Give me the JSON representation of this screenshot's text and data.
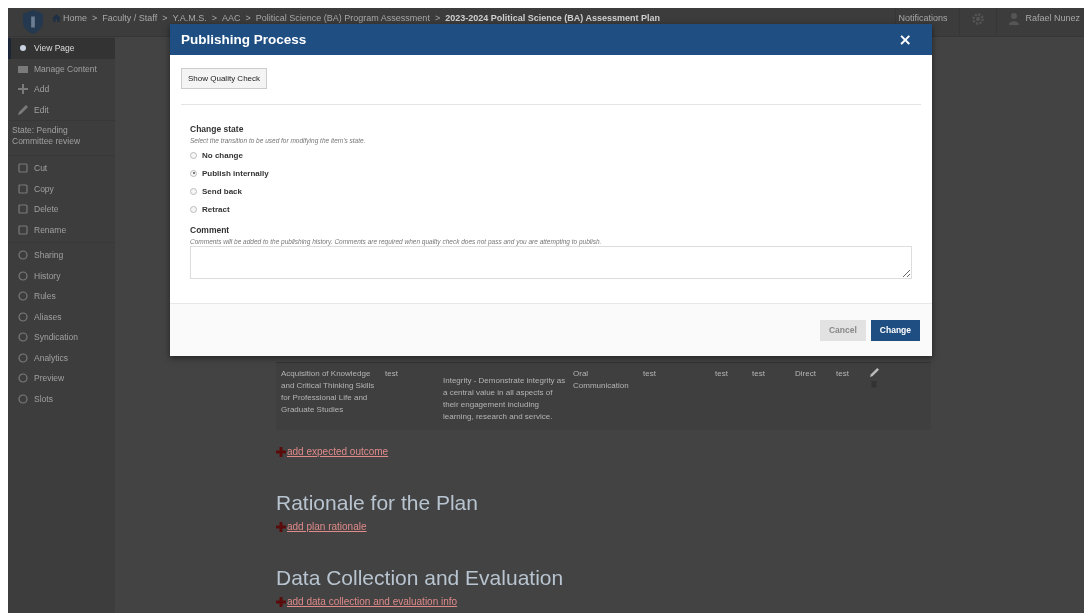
{
  "breadcrumb": [
    {
      "label": "Home",
      "kind": "home"
    },
    {
      "label": "Faculty / Staff",
      "kind": "link"
    },
    {
      "label": "Y.A.M.S.",
      "kind": "link"
    },
    {
      "label": "AAC",
      "kind": "link"
    },
    {
      "label": "Political Science (BA) Program Assessment",
      "kind": "link"
    },
    {
      "label": "2023-2024 Political Science (BA) Assessment Plan",
      "kind": "current"
    }
  ],
  "breadcrumb_separator": ">",
  "topbar": {
    "notifications": "Notifications",
    "user": "Rafael Nunez"
  },
  "sidebar": {
    "items": [
      {
        "label": "View Page",
        "selected": true
      },
      {
        "label": "Manage Content",
        "selected": false
      },
      {
        "label": "Add",
        "selected": false
      },
      {
        "label": "Edit",
        "selected": false
      }
    ],
    "state": "State: Pending Committee review",
    "actions": [
      {
        "label": "Cut"
      },
      {
        "label": "Copy"
      },
      {
        "label": "Delete"
      },
      {
        "label": "Rename"
      }
    ],
    "tools": [
      {
        "label": "Sharing"
      },
      {
        "label": "History"
      },
      {
        "label": "Rules"
      },
      {
        "label": "Aliases"
      },
      {
        "label": "Syndication"
      },
      {
        "label": "Analytics"
      },
      {
        "label": "Preview"
      },
      {
        "label": "Slots"
      }
    ]
  },
  "table": {
    "rows": [
      {
        "cells": [
          "Acquisition of Knowledge and Critical Thinking Skills for Professional Life and Graduate Studies",
          "test",
          "Integrity - Demonstrate integrity as a central value in all aspects of their engagement including learning, research and service.",
          "Oral Communication",
          "test",
          "test",
          "test",
          "Direct",
          "test"
        ]
      }
    ]
  },
  "sections": [
    {
      "kind": "link",
      "text": "add expected outcome"
    },
    {
      "kind": "heading",
      "text": "Rationale for the Plan"
    },
    {
      "kind": "link",
      "text": "add plan rationale"
    },
    {
      "kind": "heading",
      "text": "Data Collection and Evaluation"
    },
    {
      "kind": "link",
      "text": "add data collection and evaluation info"
    }
  ],
  "dialog": {
    "title": "Publishing Process",
    "close": "×",
    "quality_button": "Show Quality Check",
    "state_label": "Change state",
    "state_hint": "Select the transition to be used for modifying the item's state.",
    "options": [
      {
        "label": "No change",
        "selected": false
      },
      {
        "label": "Publish internally",
        "selected": true
      },
      {
        "label": "Send back",
        "selected": false
      },
      {
        "label": "Retract",
        "selected": false
      }
    ],
    "comment_label": "Comment",
    "comment_hint": "Comments will be added to the publishing history. Comments are required when quality check does not pass and you are attempting to publish.",
    "buttons": [
      {
        "label": "Cancel",
        "kind": "secondary"
      },
      {
        "label": "Change",
        "kind": "primary"
      }
    ]
  }
}
